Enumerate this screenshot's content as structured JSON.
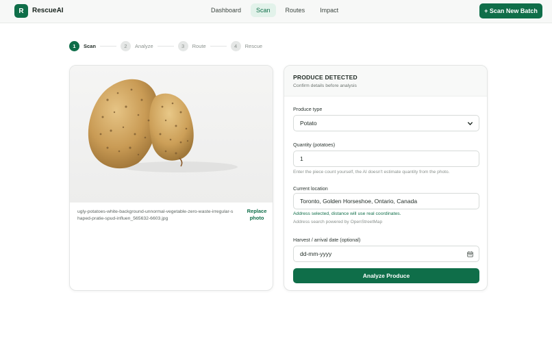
{
  "app": {
    "logo_letter": "R",
    "name": "RescueAI"
  },
  "nav": {
    "items": [
      "Dashboard",
      "Scan",
      "Routes",
      "Impact"
    ],
    "active": "Scan"
  },
  "header": {
    "new_batch_label": "+ Scan New Batch"
  },
  "stepper": [
    {
      "num": "1",
      "label": "Scan",
      "active": true
    },
    {
      "num": "2",
      "label": "Analyze",
      "active": false
    },
    {
      "num": "3",
      "label": "Route",
      "active": false
    },
    {
      "num": "4",
      "label": "Rescue",
      "active": false
    }
  ],
  "upload": {
    "file_name": "ugly-potatoes-white-background-unnormal-vegetable-zero-waste-irregular-shaped-pratie-spud-influen_565632-6603.jpg",
    "replace_label": "Replace photo"
  },
  "form": {
    "title": "PRODUCE DETECTED",
    "subtitle": "Confirm details before analysis",
    "produce_type_label": "Produce type",
    "produce_type_value": "Potato",
    "quantity_label": "Quantity (potatoes)",
    "quantity_value": "1",
    "quantity_hint": "Enter the piece count yourself, the AI doesn't estimate quantity from the photo.",
    "location_label": "Current location",
    "location_value": "Toronto, Golden Horseshoe, Ontario, Canada",
    "location_status": "Address selected, distance will use real coordinates.",
    "location_hint": "Address search powered by OpenStreetMap",
    "date_label": "Harvest / arrival date (optional)",
    "date_placeholder": "dd-mm-yyyy",
    "analyze_label": "Analyze Produce"
  },
  "colors": {
    "brand": "#0f6e49",
    "nav_active_bg": "#e2f2ea"
  }
}
